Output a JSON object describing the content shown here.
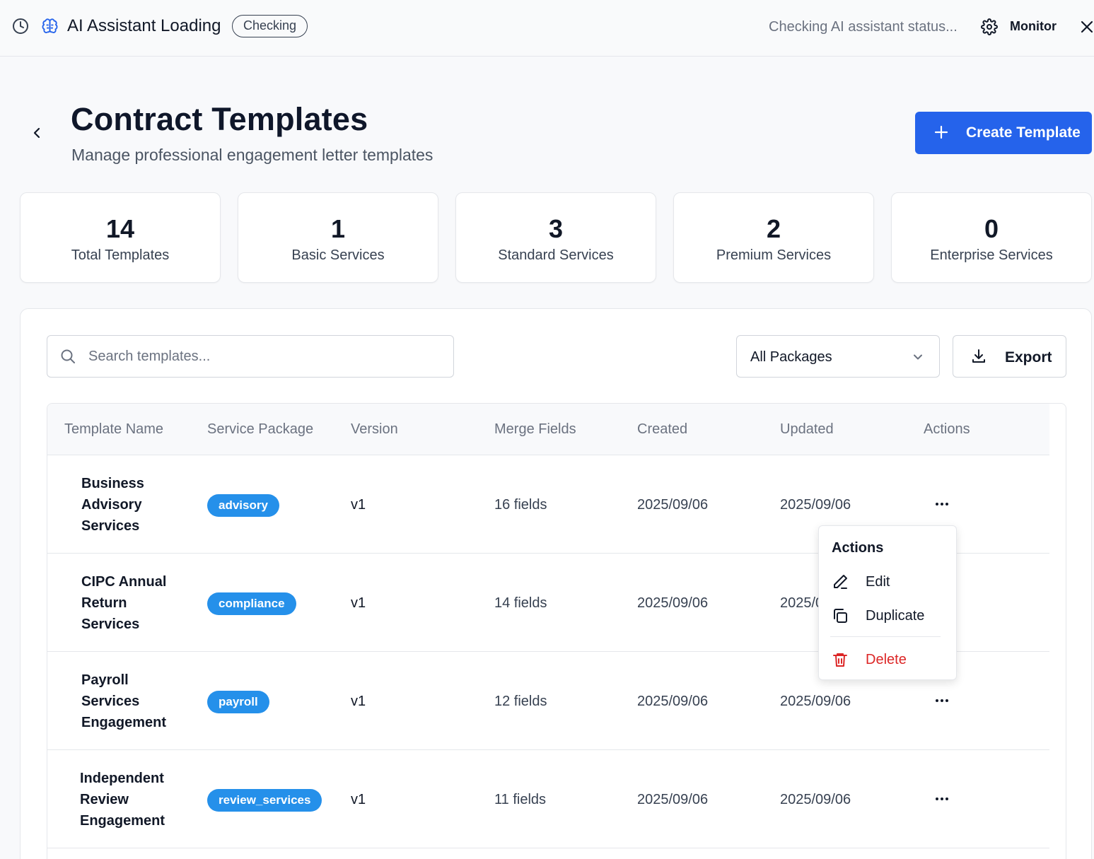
{
  "topbar": {
    "title": "AI Assistant Loading",
    "status_pill": "Checking",
    "status_text": "Checking AI assistant status...",
    "monitor_label": "Monitor"
  },
  "header": {
    "title": "Contract Templates",
    "subtitle": "Manage professional engagement letter templates",
    "create_label": "Create Template"
  },
  "stats": [
    {
      "value": "14",
      "label": "Total Templates"
    },
    {
      "value": "1",
      "label": "Basic Services"
    },
    {
      "value": "3",
      "label": "Standard Services"
    },
    {
      "value": "2",
      "label": "Premium Services"
    },
    {
      "value": "0",
      "label": "Enterprise Services"
    }
  ],
  "toolbar": {
    "search_placeholder": "Search templates...",
    "package_filter": "All Packages",
    "export_label": "Export"
  },
  "table": {
    "columns": [
      "Template Name",
      "Service Package",
      "Version",
      "Merge Fields",
      "Created",
      "Updated",
      "Actions"
    ],
    "rows": [
      {
        "name": "Business Advisory Services",
        "package": "advisory",
        "version": "v1",
        "fields": "16 fields",
        "created": "2025/09/06",
        "updated": "2025/09/06"
      },
      {
        "name": "CIPC Annual Return Services",
        "package": "compliance",
        "version": "v1",
        "fields": "14 fields",
        "created": "2025/09/06",
        "updated": "2025/09/06"
      },
      {
        "name": "Payroll Services Engagement",
        "package": "payroll",
        "version": "v1",
        "fields": "12 fields",
        "created": "2025/09/06",
        "updated": "2025/09/06"
      },
      {
        "name": "Independent Review Engagement",
        "package": "review_services",
        "version": "v1",
        "fields": "11 fields",
        "created": "2025/09/06",
        "updated": "2025/09/06"
      }
    ]
  },
  "actions_menu": {
    "header": "Actions",
    "items": [
      {
        "label": "Edit",
        "icon": "pencil-icon"
      },
      {
        "label": "Duplicate",
        "icon": "copy-icon"
      },
      {
        "label": "Delete",
        "icon": "trash-icon"
      }
    ]
  },
  "colors": {
    "primary": "#2563eb",
    "badge": "#2590ea",
    "danger": "#dc2626"
  }
}
